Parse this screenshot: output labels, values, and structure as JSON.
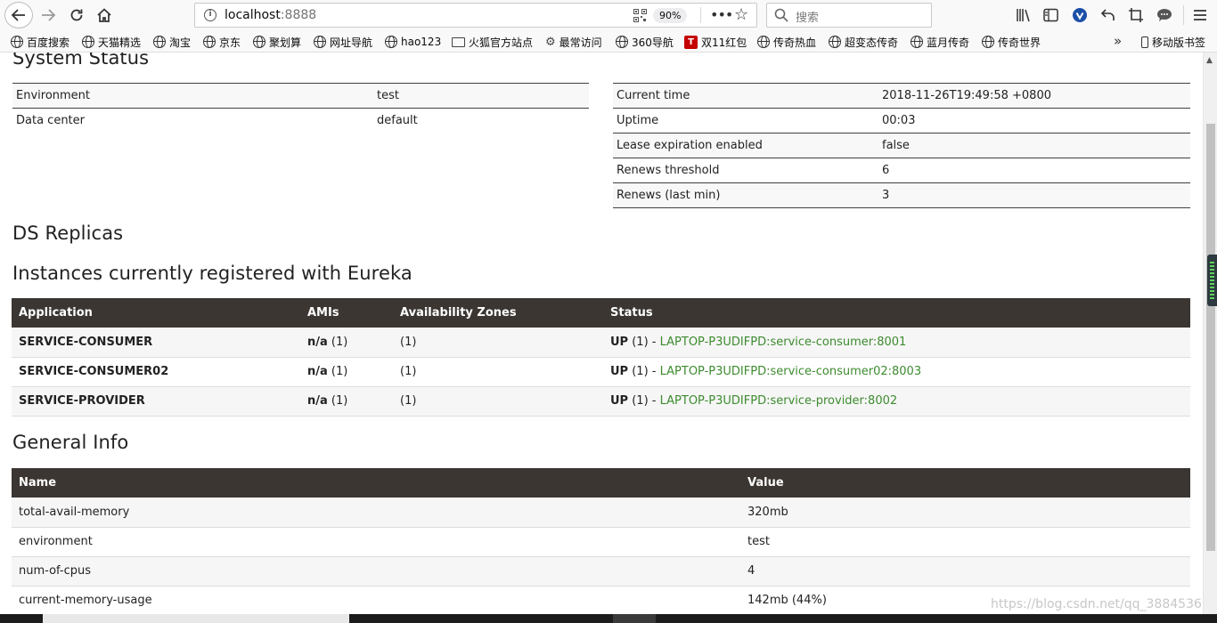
{
  "browser": {
    "url_host": "localhost",
    "url_port": ":8888",
    "zoom": "90%",
    "search_placeholder": "搜索",
    "nav_icons": [
      "back-arrow-icon",
      "forward-arrow-icon",
      "reload-icon",
      "home-icon"
    ],
    "toolbar_icons": [
      "library-icon",
      "sidebar-icon",
      "extension-icon",
      "undo-icon",
      "crop-icon",
      "chat-icon",
      "menu-icon"
    ]
  },
  "bookmarks": [
    {
      "label": "百度搜索",
      "icon": "globe-icon"
    },
    {
      "label": "天猫精选",
      "icon": "globe-icon"
    },
    {
      "label": "淘宝",
      "icon": "globe-icon"
    },
    {
      "label": "京东",
      "icon": "globe-icon"
    },
    {
      "label": "聚划算",
      "icon": "globe-icon"
    },
    {
      "label": "网址导航",
      "icon": "globe-icon"
    },
    {
      "label": "hao123",
      "icon": "globe-icon"
    },
    {
      "label": "火狐官方站点",
      "icon": "folder-icon"
    },
    {
      "label": "最常访问",
      "icon": "gear-icon"
    },
    {
      "label": "360导航",
      "icon": "globe-icon"
    },
    {
      "label": "双11红包",
      "icon": "tmall-icon"
    },
    {
      "label": "传奇热血",
      "icon": "globe-icon"
    },
    {
      "label": "超变态传奇",
      "icon": "globe-icon"
    },
    {
      "label": "蓝月传奇",
      "icon": "globe-icon"
    },
    {
      "label": "传奇世界",
      "icon": "globe-icon"
    }
  ],
  "bookmarks_mobile": "移动版书签",
  "page": {
    "system_status_title": "System Status",
    "status_left": [
      {
        "key": "Environment",
        "value": "test"
      },
      {
        "key": "Data center",
        "value": "default"
      }
    ],
    "status_right": [
      {
        "key": "Current time",
        "value": "2018-11-26T19:49:58 +0800"
      },
      {
        "key": "Uptime",
        "value": "00:03"
      },
      {
        "key": "Lease expiration enabled",
        "value": "false"
      },
      {
        "key": "Renews threshold",
        "value": "6"
      },
      {
        "key": "Renews (last min)",
        "value": "3"
      }
    ],
    "ds_replicas_title": "DS Replicas",
    "instances_title": "Instances currently registered with Eureka",
    "instances_headers": [
      "Application",
      "AMIs",
      "Availability Zones",
      "Status"
    ],
    "instances": [
      {
        "app": "SERVICE-CONSUMER",
        "ami_bold": "n/a",
        "ami_count": " (1)",
        "zones": "(1)",
        "status_bold": "UP",
        "status_count": " (1) - ",
        "link": "LAPTOP-P3UDIFPD:service-consumer:8001"
      },
      {
        "app": "SERVICE-CONSUMER02",
        "ami_bold": "n/a",
        "ami_count": " (1)",
        "zones": "(1)",
        "status_bold": "UP",
        "status_count": " (1) - ",
        "link": "LAPTOP-P3UDIFPD:service-consumer02:8003"
      },
      {
        "app": "SERVICE-PROVIDER",
        "ami_bold": "n/a",
        "ami_count": " (1)",
        "zones": "(1)",
        "status_bold": "UP",
        "status_count": " (1) - ",
        "link": "LAPTOP-P3UDIFPD:service-provider:8002"
      }
    ],
    "general_info_title": "General Info",
    "info_headers": [
      "Name",
      "Value"
    ],
    "info": [
      {
        "name": "total-avail-memory",
        "value": "320mb"
      },
      {
        "name": "environment",
        "value": "test"
      },
      {
        "name": "num-of-cpus",
        "value": "4"
      },
      {
        "name": "current-memory-usage",
        "value": "142mb (44%)"
      }
    ],
    "watermark": "https://blog.csdn.net/qq_3884536"
  },
  "colors": {
    "table_header_bg": "#3b3632",
    "link_green": "#3d8b2f"
  }
}
